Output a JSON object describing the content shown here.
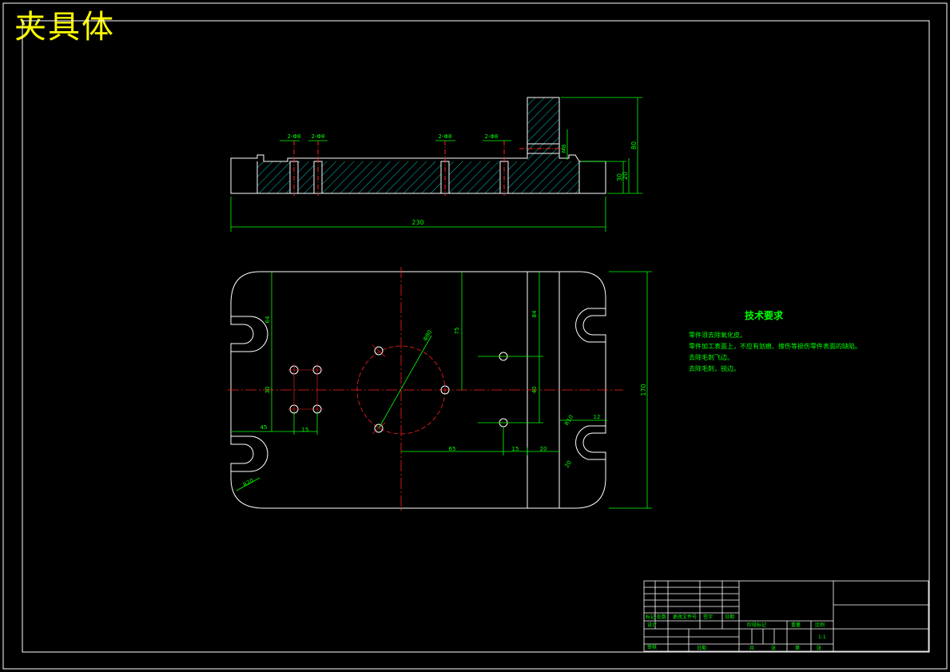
{
  "drawing_title": "夹具体",
  "tech_requirements": {
    "title": "技术要求",
    "lines": [
      "零件须去除氧化皮。",
      "零件加工表面上，不应有划痕、擦伤等损伤零件表面的缺陷。",
      "去除毛刺飞边。",
      "去除毛刺，锐边。"
    ]
  },
  "section_view_dims": {
    "overall_length": "230",
    "total_height": "80",
    "heights": [
      "30",
      "20"
    ],
    "slot": "M8",
    "holes": [
      "2-Φ8",
      "2-Φ8",
      "2-Φ8",
      "2-Φ8"
    ]
  },
  "plan_view_dims": {
    "overall_height": "170",
    "corner_radius": "R20",
    "circle_dia": "Φ80",
    "dist_45": "45",
    "dist_15": "15",
    "dist_65": "65",
    "dist_15b": "15",
    "dist_20": "20",
    "dist_75": "75",
    "dist_84": "84",
    "dist_40": "40",
    "dist_30": "30",
    "dist_12": "12",
    "slot_r": "R10",
    "slot_w": "20",
    "dist_64": "64"
  },
  "title_block": {
    "scale": "1:1",
    "labels": [
      "标记",
      "处数",
      "更改文件号",
      "签字",
      "日期",
      "设计",
      "审核",
      "阶段标记",
      "重量",
      "比例",
      "共",
      "张",
      "第",
      "张",
      "日期"
    ]
  }
}
